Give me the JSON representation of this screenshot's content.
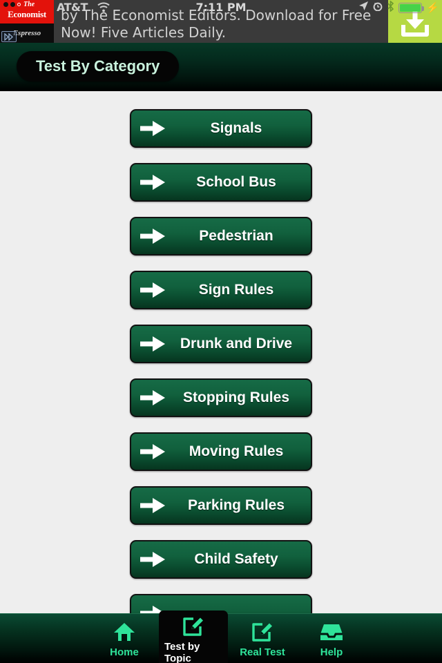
{
  "status_bar": {
    "carrier": "AT&T",
    "time": "7:11 PM",
    "wifi_icon": "wifi-icon",
    "location_icon": "location-arrow-icon",
    "alarm_icon": "alarm-clock-icon",
    "bluetooth_icon": "bluetooth-icon",
    "battery_icon": "battery-icon",
    "charging_icon": "lightning-bolt-icon"
  },
  "ad": {
    "brand_the": "The",
    "brand_name": "Economist",
    "brand_product": "Espresso",
    "body_text": "by The Economist Editors. Download for Free Now! Five Articles Daily.",
    "cta_icon": "download-icon",
    "adchoices_icon": "adchoices-icon",
    "background_color": "#3a3a3a",
    "cta_background_color": "#b6d943",
    "brand_color": "#e3120b"
  },
  "navbar": {
    "title": "Test By Category",
    "background_gradient_top": "#063826",
    "background_gradient_bottom": "#000000",
    "title_color": "#c9f2dd"
  },
  "categories": [
    {
      "label": "Signals",
      "icon": "arrow-right-icon"
    },
    {
      "label": "School Bus",
      "icon": "arrow-right-icon"
    },
    {
      "label": "Pedestrian",
      "icon": "arrow-right-icon"
    },
    {
      "label": "Sign Rules",
      "icon": "arrow-right-icon"
    },
    {
      "label": "Drunk and Drive",
      "icon": "arrow-right-icon"
    },
    {
      "label": "Stopping Rules",
      "icon": "arrow-right-icon"
    },
    {
      "label": "Moving Rules",
      "icon": "arrow-right-icon"
    },
    {
      "label": "Parking Rules",
      "icon": "arrow-right-icon"
    },
    {
      "label": "Child Safety",
      "icon": "arrow-right-icon"
    },
    {
      "label": "",
      "icon": "arrow-right-icon"
    }
  ],
  "button_style": {
    "fill_top": "#166b46",
    "fill_bottom": "#06351f",
    "border_color": "#111111",
    "text_color": "#ffffff"
  },
  "tabbar": {
    "accent_color": "#2fe39a",
    "selected_text_color": "#ffffff",
    "items": [
      {
        "label": "Home",
        "icon": "home-icon",
        "selected": false
      },
      {
        "label": "Test by Topic",
        "icon": "compose-pencil-icon",
        "selected": true
      },
      {
        "label": "Real Test",
        "icon": "compose-pencil-icon",
        "selected": false
      },
      {
        "label": "Help",
        "icon": "inbox-tray-icon",
        "selected": false
      }
    ]
  }
}
